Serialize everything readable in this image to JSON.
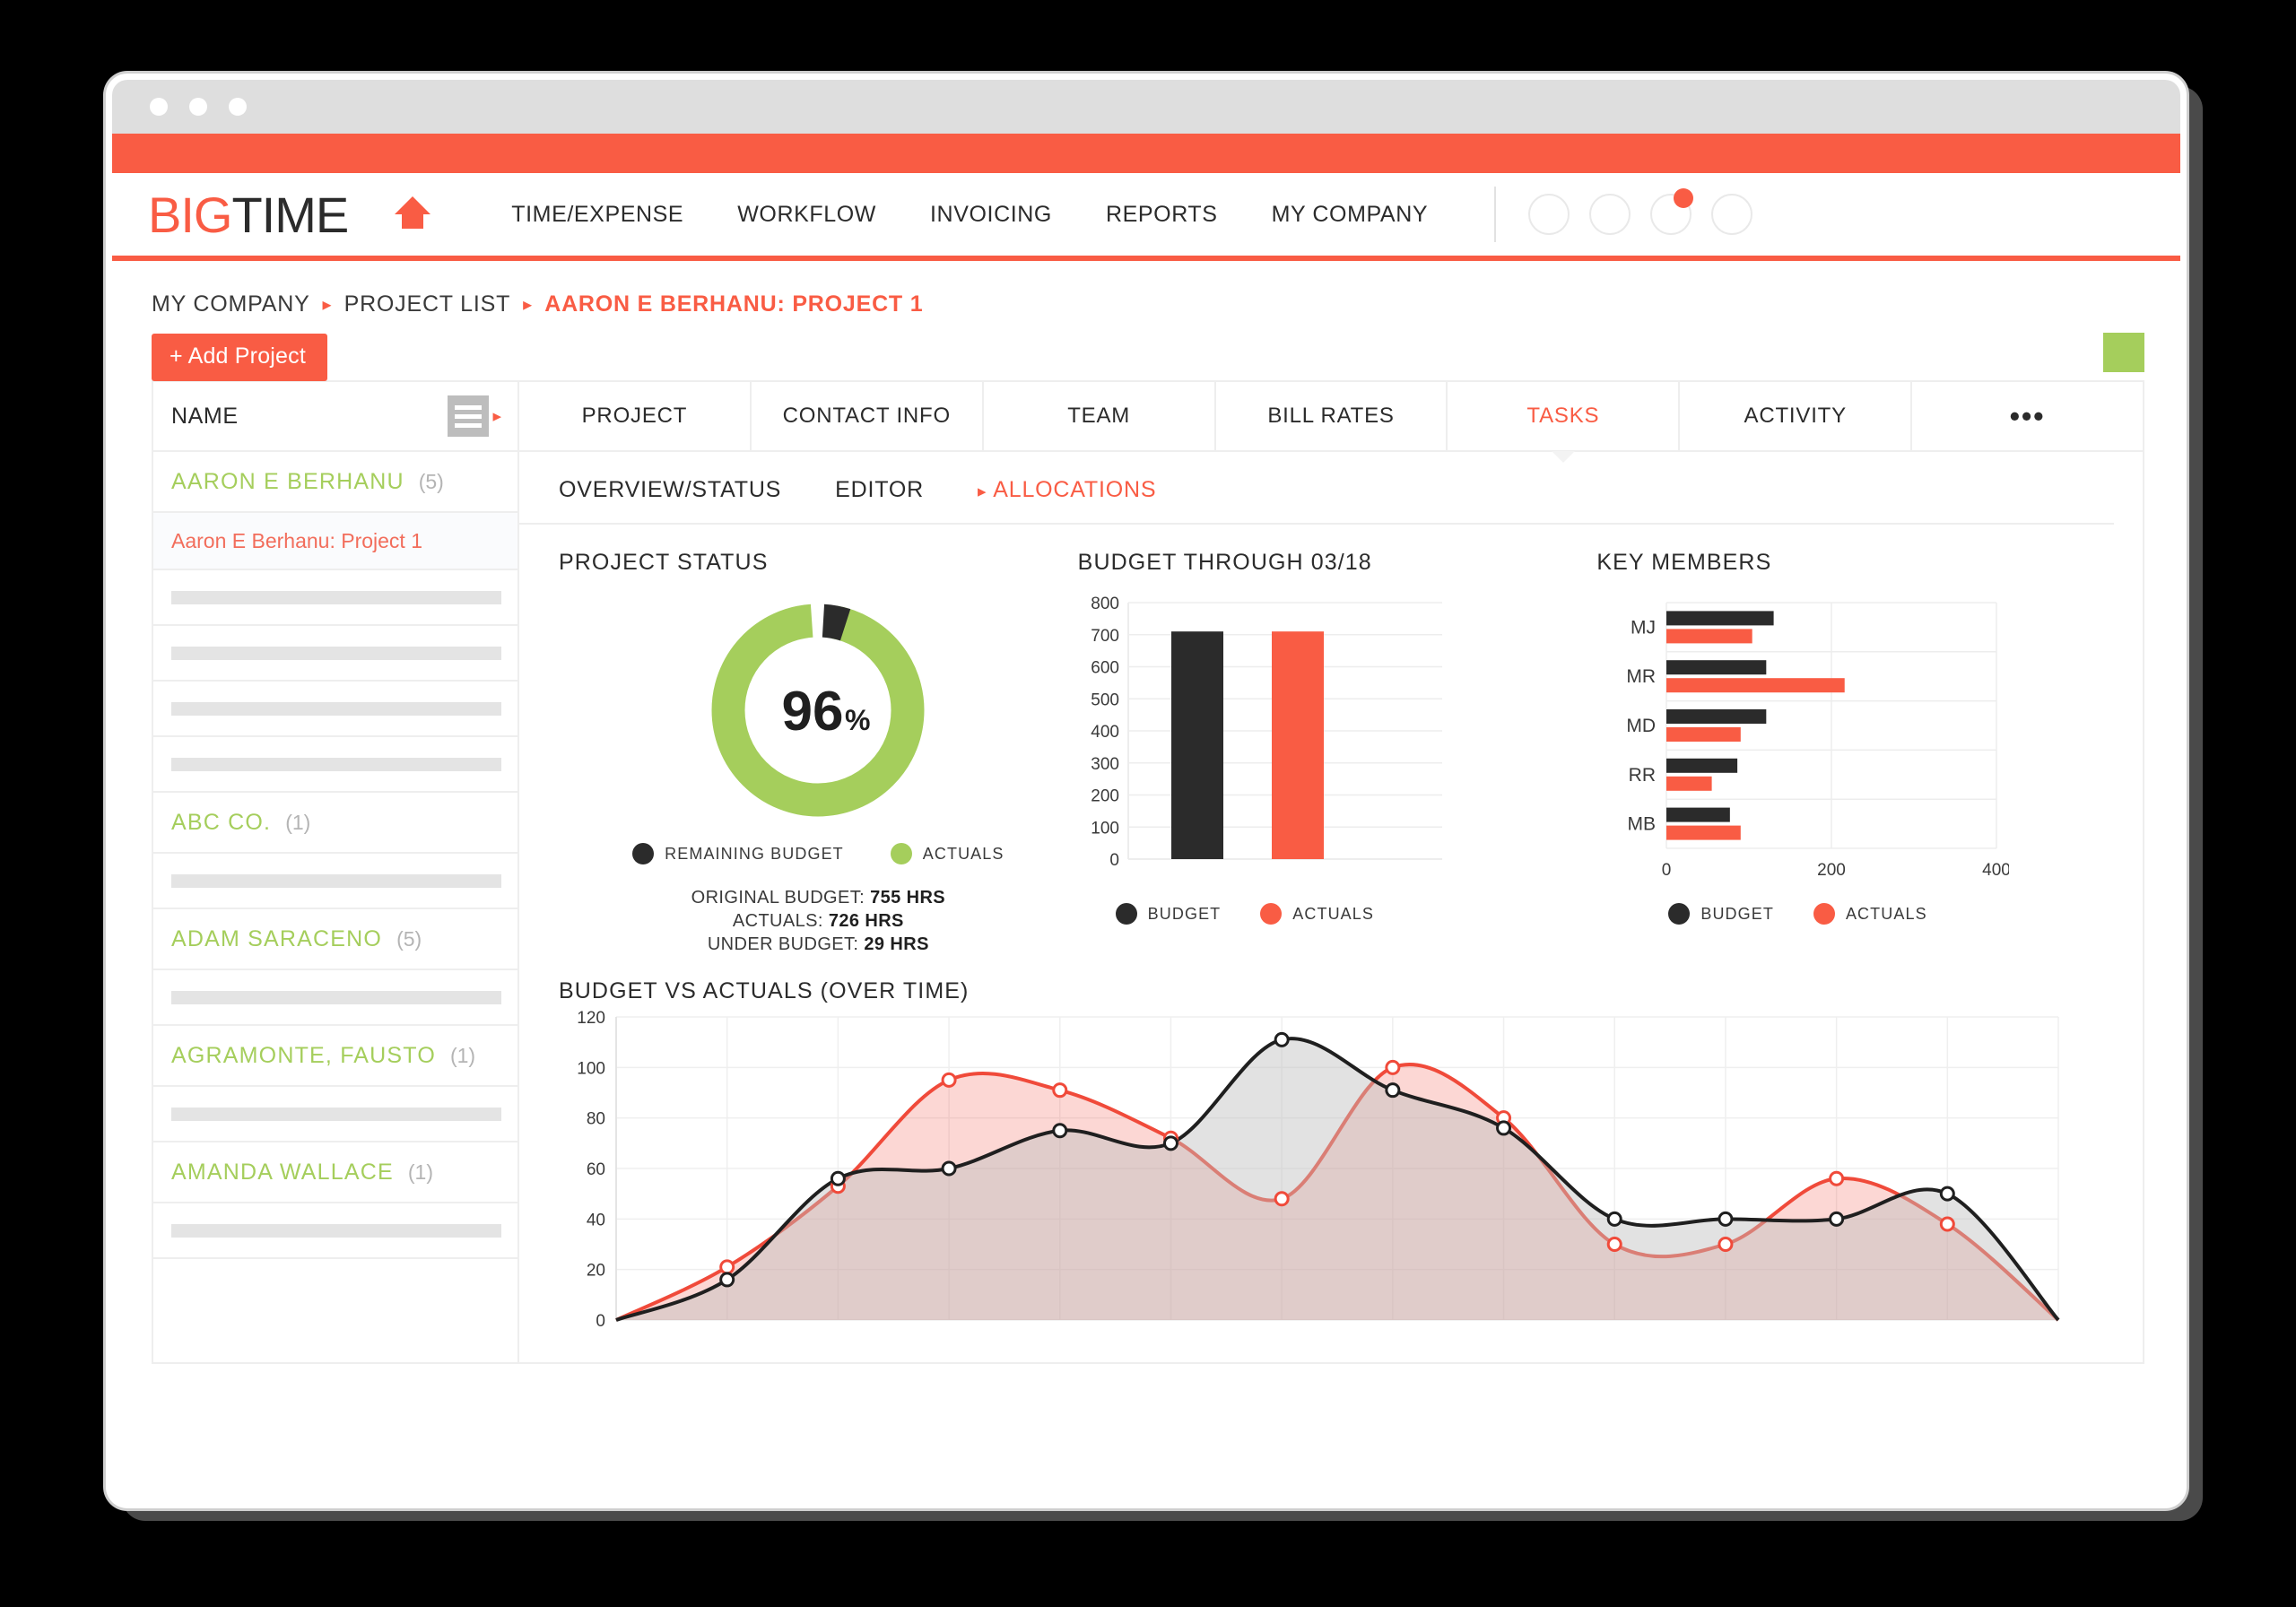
{
  "window": {
    "dots": [
      "dot-1",
      "dot-2",
      "dot-3"
    ]
  },
  "header": {
    "logo_first": "BIG",
    "logo_second": "TIME",
    "home_icon": "home-icon",
    "nav": [
      {
        "label": "TIME/EXPENSE"
      },
      {
        "label": "WORKFLOW"
      },
      {
        "label": "INVOICING"
      },
      {
        "label": "REPORTS"
      },
      {
        "label": "MY COMPANY"
      }
    ],
    "avatars": [
      "avatar-1",
      "avatar-2",
      "avatar-3",
      "avatar-4"
    ],
    "notification_badge": "notification-badge",
    "accent_color": "#f95c44"
  },
  "breadcrumb": [
    {
      "label": "MY COMPANY",
      "accent": false
    },
    {
      "label": "PROJECT LIST",
      "accent": false
    },
    {
      "label": "AARON E BERHANU: PROJECT 1",
      "accent": true
    }
  ],
  "toolbar": {
    "add_project_label": "+ Add Project",
    "green_marker_color": "#a5ce5c"
  },
  "sidebar": {
    "column_header": "NAME",
    "menu_icon": "list-view-icon",
    "rows": [
      {
        "type": "group",
        "label": "AARON E BERHANU",
        "count": "(5)"
      },
      {
        "type": "selected",
        "label": "Aaron E Berhanu: Project 1"
      },
      {
        "type": "skeleton"
      },
      {
        "type": "skeleton"
      },
      {
        "type": "skeleton"
      },
      {
        "type": "skeleton"
      },
      {
        "type": "group",
        "label": "ABC CO.",
        "count": "(1)"
      },
      {
        "type": "skeleton"
      },
      {
        "type": "group",
        "label": "ADAM SARACENO",
        "count": "(5)"
      },
      {
        "type": "skeleton"
      },
      {
        "type": "group",
        "label": "AGRAMONTE, FAUSTO",
        "count": "(1)"
      },
      {
        "type": "skeleton"
      },
      {
        "type": "group",
        "label": "AMANDA WALLACE",
        "count": "(1)"
      },
      {
        "type": "skeleton"
      },
      {
        "type": "blank"
      }
    ]
  },
  "tabs": [
    {
      "label": "PROJECT",
      "active": false
    },
    {
      "label": "CONTACT INFO",
      "active": false
    },
    {
      "label": "TEAM",
      "active": false
    },
    {
      "label": "BILL RATES",
      "active": false
    },
    {
      "label": "TASKS",
      "active": true
    },
    {
      "label": "ACTIVITY",
      "active": false
    },
    {
      "label": "•••",
      "active": false
    }
  ],
  "subtabs": [
    {
      "label": "OVERVIEW/STATUS",
      "active": false
    },
    {
      "label": "EDITOR",
      "active": false
    },
    {
      "label": "ALLOCATIONS",
      "active": true
    }
  ],
  "project_status": {
    "title": "PROJECT STATUS",
    "center_value": "96",
    "center_unit": "%",
    "legend": [
      {
        "label": "REMAINING BUDGET",
        "color": "#2b2b2b"
      },
      {
        "label": "ACTUALS",
        "color": "#a5ce5c"
      }
    ],
    "stats": [
      {
        "label": "ORIGINAL BUDGET:",
        "value": "755 HRS"
      },
      {
        "label": "ACTUALS:",
        "value": "726 HRS"
      },
      {
        "label": "UNDER BUDGET:",
        "value": "29 HRS"
      }
    ]
  },
  "chart_data": [
    {
      "id": "project-status-donut",
      "type": "pie",
      "title": "PROJECT STATUS",
      "center_label": "96%",
      "labels": [
        "ACTUALS",
        "REMAINING BUDGET"
      ],
      "values": [
        96,
        4
      ],
      "colors": [
        "#a5ce5c",
        "#2b2b2b"
      ],
      "legend": "bottom",
      "annotations": [
        "ORIGINAL BUDGET: 755 HRS",
        "ACTUALS: 726 HRS",
        "UNDER BUDGET: 29 HRS"
      ]
    },
    {
      "id": "budget-through-bar",
      "type": "bar",
      "title": "BUDGET THROUGH 03/18",
      "categories": [
        "BUDGET",
        "ACTUALS"
      ],
      "values": [
        710,
        710
      ],
      "colors": [
        "#2b2b2b",
        "#f95c44"
      ],
      "ylim": [
        0,
        800
      ],
      "yticks": [
        0,
        100,
        200,
        300,
        400,
        500,
        600,
        700,
        800
      ],
      "ylabel": "",
      "xlabel": "",
      "grid": true,
      "legend": "bottom",
      "legend_entries": [
        "BUDGET",
        "ACTUALS"
      ]
    },
    {
      "id": "key-members-bar",
      "type": "bar",
      "orientation": "horizontal",
      "title": "KEY MEMBERS",
      "categories": [
        "MJ",
        "MR",
        "MD",
        "RR",
        "MB"
      ],
      "series": [
        {
          "name": "BUDGET",
          "color": "#2b2b2b",
          "values": [
            130,
            121,
            121,
            86,
            77
          ]
        },
        {
          "name": "ACTUALS",
          "color": "#f95c44",
          "values": [
            104,
            216,
            90,
            55,
            90
          ]
        }
      ],
      "xlim": [
        0,
        400
      ],
      "xticks": [
        0,
        200,
        400
      ],
      "grid": true,
      "legend": "bottom",
      "legend_entries": [
        "BUDGET",
        "ACTUALS"
      ]
    },
    {
      "id": "budget-vs-actuals-over-time",
      "type": "area",
      "title": "BUDGET VS ACTUALS (OVER TIME)",
      "x": [
        0,
        1,
        2,
        3,
        4,
        5,
        6,
        7,
        8,
        9,
        10,
        11,
        12,
        13
      ],
      "ylim": [
        0,
        120
      ],
      "yticks": [
        0,
        20,
        40,
        60,
        80,
        100,
        120
      ],
      "xlabel": "",
      "ylabel": "",
      "grid": true,
      "series": [
        {
          "name": "BUDGET",
          "color": "#1f1f1f",
          "fill": "rgba(190,190,190,0.45)",
          "values": [
            0,
            16,
            56,
            60,
            75,
            70,
            111,
            91,
            76,
            40,
            40,
            40,
            50,
            0
          ]
        },
        {
          "name": "ACTUALS",
          "color": "#f04a3a",
          "fill": "rgba(240,74,58,0.22)",
          "values": [
            0,
            21,
            53,
            95,
            91,
            72,
            48,
            100,
            80,
            30,
            30,
            56,
            38,
            0
          ]
        }
      ]
    }
  ],
  "budget_through": {
    "title": "BUDGET THROUGH 03/18"
  },
  "key_members": {
    "title": "KEY MEMBERS"
  },
  "over_time": {
    "title": "BUDGET VS ACTUALS (OVER TIME)"
  }
}
